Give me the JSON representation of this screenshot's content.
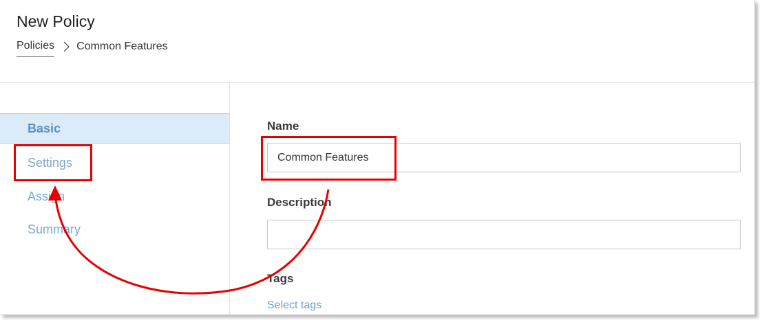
{
  "header": {
    "title": "New Policy",
    "breadcrumb": {
      "parent": "Policies",
      "current": "Common Features"
    }
  },
  "sidebar": {
    "items": [
      {
        "label": "Basic",
        "active": true
      },
      {
        "label": "Settings",
        "active": false
      },
      {
        "label": "Assign",
        "active": false
      },
      {
        "label": "Summary",
        "active": false
      }
    ]
  },
  "form": {
    "name_label": "Name",
    "name_value": "Common Features",
    "description_label": "Description",
    "description_value": "",
    "tags_label": "Tags",
    "tags_link": "Select tags"
  },
  "colors": {
    "accent": "#5d8fc6",
    "annotation": "#e60000",
    "active_bg": "#dcebf8"
  },
  "icons": {
    "breadcrumb_separator": "chevron-right-icon"
  }
}
